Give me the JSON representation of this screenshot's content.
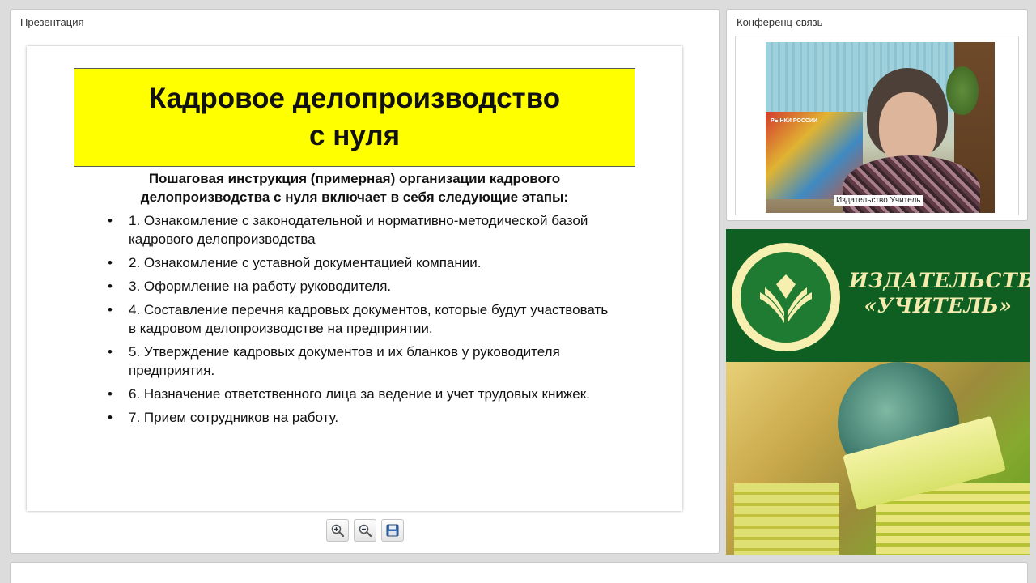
{
  "presentation": {
    "panel_title": "Презентация",
    "slide": {
      "title": "Кадровое делопроизводство\nс нуля",
      "intro": "Пошаговая инструкция (примерная) организации кадрового делопроизводства с нуля включает в себя следующие этапы:",
      "bullet": "•",
      "items": [
        "1. Ознакомление с законодательной и нормативно-методической базой кадрового делопроизводства",
        "2. Ознакомление с уставной документацией компании.",
        "3. Оформление на работу руководителя.",
        "4. Составление перечня кадровых документов, которые будут участвовать в кадровом делопроизводстве на предприятии.",
        "5. Утверждение кадровых документов и их бланков у руководителя предприятия.",
        "6. Назначение ответственного лица за ведение и учет трудовых книжек.",
        "7. Прием сотрудников на работу."
      ],
      "title_bg_color": "#ffff00"
    },
    "toolbar": {
      "zoom_in_icon": "magnifier-plus",
      "zoom_out_icon": "magnifier-minus",
      "save_icon": "floppy-disk"
    }
  },
  "conference": {
    "panel_title": "Конференц-связь",
    "video_caption": "Издательство Учитель",
    "poster_text": "РЫНКИ РОССИИ"
  },
  "publisher": {
    "name": "ИЗДАТЕЛЬСТВО\n«УЧИТЕЛЬ»",
    "banner_color": "#0f5f22",
    "text_color": "#f4ecae"
  }
}
